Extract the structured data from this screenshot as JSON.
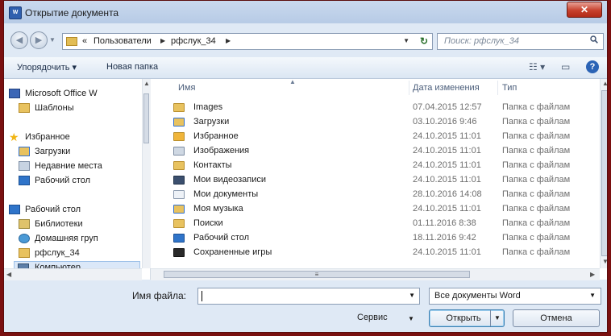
{
  "window": {
    "title": "Открытие документа",
    "close_label": "✕"
  },
  "navigation": {
    "back_icon": "back-arrow-icon",
    "forward_icon": "forward-arrow-icon",
    "breadcrumb_prefix": "«",
    "breadcrumbs": [
      "Пользователи",
      "рфслук_34"
    ],
    "search_placeholder": "Поиск: рфслук_34"
  },
  "toolbar": {
    "organize_label": "Упорядочить ▾",
    "new_folder_label": "Новая папка",
    "views_label": "☷ ▾",
    "preview_label": "▭",
    "help_label": "?"
  },
  "nav_pane": {
    "items": [
      {
        "label": "Microsoft Office W",
        "icon": "office-icon"
      },
      {
        "label": "Шаблоны",
        "icon": "folder-icon"
      },
      {
        "label": "Избранное",
        "icon": "star-icon"
      },
      {
        "label": "Загрузки",
        "icon": "downloads-icon"
      },
      {
        "label": "Недавние места",
        "icon": "recent-icon"
      },
      {
        "label": "Рабочий стол",
        "icon": "desktop-icon"
      },
      {
        "label": "Рабочий стол",
        "icon": "desktop-icon"
      },
      {
        "label": "Библиотеки",
        "icon": "library-icon"
      },
      {
        "label": "Домашняя груп",
        "icon": "homegroup-icon"
      },
      {
        "label": "рфслук_34",
        "icon": "user-folder-icon"
      },
      {
        "label": "Компьютер",
        "icon": "computer-icon"
      }
    ]
  },
  "file_list": {
    "columns": {
      "name": "Имя",
      "date": "Дата изменения",
      "type": "Тип"
    },
    "rows": [
      {
        "name": "Images",
        "date": "07.04.2015 12:57",
        "type": "Папка с файлам"
      },
      {
        "name": "Загрузки",
        "date": "03.10.2016 9:46",
        "type": "Папка с файлам"
      },
      {
        "name": "Избранное",
        "date": "24.10.2015 11:01",
        "type": "Папка с файлам"
      },
      {
        "name": "Изображения",
        "date": "24.10.2015 11:01",
        "type": "Папка с файлам"
      },
      {
        "name": "Контакты",
        "date": "24.10.2015 11:01",
        "type": "Папка с файлам"
      },
      {
        "name": "Мои видеозаписи",
        "date": "24.10.2015 11:01",
        "type": "Папка с файлам"
      },
      {
        "name": "Мои документы",
        "date": "28.10.2016 14:08",
        "type": "Папка с файлам"
      },
      {
        "name": "Моя музыка",
        "date": "24.10.2015 11:01",
        "type": "Папка с файлам"
      },
      {
        "name": "Поиски",
        "date": "01.11.2016 8:38",
        "type": "Папка с файлам"
      },
      {
        "name": "Рабочий стол",
        "date": "18.11.2016 9:42",
        "type": "Папка с файлам"
      },
      {
        "name": "Сохраненные игры",
        "date": "24.10.2015 11:01",
        "type": "Папка с файлам"
      }
    ]
  },
  "bottom": {
    "filename_label": "Имя файла:",
    "filename_value": "",
    "filetype_value": "Все документы Word",
    "tools_label": "Сервис",
    "open_label": "Открыть",
    "cancel_label": "Отмена"
  },
  "colors": {
    "frame": "#7a1010",
    "accent": "#2b63b5",
    "folder": "#e8c25f"
  }
}
